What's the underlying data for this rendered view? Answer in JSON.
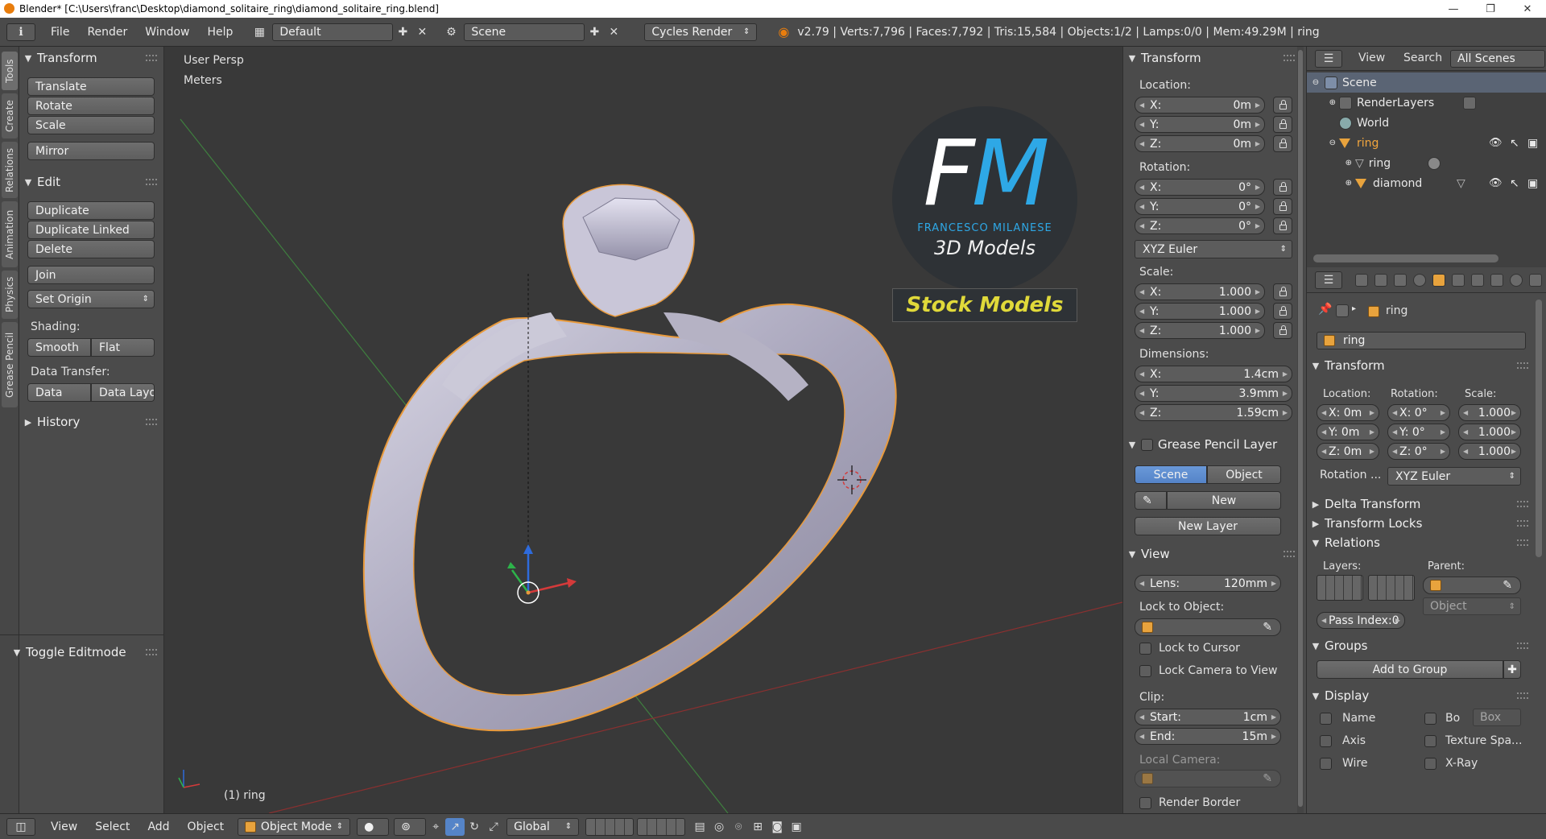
{
  "window": {
    "title": "Blender* [C:\\Users\\franc\\Desktop\\diamond_solitaire_ring\\diamond_solitaire_ring.blend]",
    "minimize": "—",
    "maximize": "❐",
    "close": "✕"
  },
  "topbar": {
    "info_icon": "ℹ",
    "menus": [
      "File",
      "Render",
      "Window",
      "Help"
    ],
    "screen_layout": "Default",
    "scene": "Scene",
    "engine": "Cycles Render",
    "stats": "v2.79 | Verts:7,796 | Faces:7,792 | Tris:15,584 | Objects:1/2 | Lamps:0/0 | Mem:49.29M | ring"
  },
  "tool_tabs": [
    "Tools",
    "Create",
    "Relations",
    "Animation",
    "Physics",
    "Grease Pencil"
  ],
  "toolshelf": {
    "transform_header": "Transform",
    "translate": "Translate",
    "rotate": "Rotate",
    "scale": "Scale",
    "mirror": "Mirror",
    "edit_header": "Edit",
    "duplicate": "Duplicate",
    "duplicate_linked": "Duplicate Linked",
    "delete": "Delete",
    "join": "Join",
    "set_origin": "Set Origin",
    "shading_label": "Shading:",
    "smooth": "Smooth",
    "flat": "Flat",
    "data_transfer_label": "Data Transfer:",
    "data": "Data",
    "data_layout": "Data Layo",
    "history_header": "History",
    "toggle_editmode": "Toggle Editmode"
  },
  "viewport": {
    "view_name": "User Persp",
    "units": "Meters",
    "object_label": "(1) ring",
    "watermark_initials": "FM",
    "watermark_name": "FRANCESCO MILANESE",
    "watermark_sub": "3D Models",
    "watermark_banner": "Stock Models",
    "colors": {
      "background": "#393939",
      "ring": "#b7b4c8",
      "outline": "#e89a3c"
    }
  },
  "npanel": {
    "transform_header": "Transform",
    "location_label": "Location:",
    "location": [
      {
        "axis": "X:",
        "value": "0m"
      },
      {
        "axis": "Y:",
        "value": "0m"
      },
      {
        "axis": "Z:",
        "value": "0m"
      }
    ],
    "rotation_label": "Rotation:",
    "rotation": [
      {
        "axis": "X:",
        "value": "0°"
      },
      {
        "axis": "Y:",
        "value": "0°"
      },
      {
        "axis": "Z:",
        "value": "0°"
      }
    ],
    "rotation_mode": "XYZ Euler",
    "scale_label": "Scale:",
    "scale": [
      {
        "axis": "X:",
        "value": "1.000"
      },
      {
        "axis": "Y:",
        "value": "1.000"
      },
      {
        "axis": "Z:",
        "value": "1.000"
      }
    ],
    "dimensions_label": "Dimensions:",
    "dimensions": [
      {
        "axis": "X:",
        "value": "1.4cm"
      },
      {
        "axis": "Y:",
        "value": "3.9mm"
      },
      {
        "axis": "Z:",
        "value": "1.59cm"
      }
    ],
    "grease_pencil_header": "Grease Pencil Layer",
    "gp_scene": "Scene",
    "gp_object": "Object",
    "gp_new": "New",
    "gp_new_layer": "New Layer",
    "view_header": "View",
    "lens_label": "Lens:",
    "lens_value": "120mm",
    "lock_to_object_label": "Lock to Object:",
    "lock_to_cursor": "Lock to Cursor",
    "lock_camera_to_view": "Lock Camera to View",
    "clip_label": "Clip:",
    "clip_start_label": "Start:",
    "clip_start": "1cm",
    "clip_end_label": "End:",
    "clip_end": "15m",
    "local_camera_label": "Local Camera:",
    "render_border": "Render Border"
  },
  "outliner": {
    "view": "View",
    "search": "Search",
    "filter": "All Scenes",
    "rows": [
      {
        "label": "Scene",
        "indent": 0
      },
      {
        "label": "RenderLayers",
        "indent": 1
      },
      {
        "label": "World",
        "indent": 1
      },
      {
        "label": "ring",
        "indent": 1
      },
      {
        "label": "ring",
        "indent": 2
      },
      {
        "label": "diamond",
        "indent": 2
      }
    ]
  },
  "properties": {
    "breadcrumb": "ring",
    "object_name": "ring",
    "transform_header": "Transform",
    "location_label": "Location:",
    "rotation_label": "Rotation:",
    "scale_label": "Scale:",
    "loc": [
      "X: 0m",
      "Y: 0m",
      "Z: 0m"
    ],
    "rot": [
      "X:  0°",
      "Y:  0°",
      "Z:  0°"
    ],
    "scl": [
      "1.000",
      "1.000",
      "1.000"
    ],
    "rotation_mode_label": "Rotation ...",
    "rotation_mode": "XYZ Euler",
    "delta_transform": "Delta Transform",
    "transform_locks": "Transform Locks",
    "relations": "Relations",
    "layers_label": "Layers:",
    "parent_label": "Parent:",
    "parent_type": "Object",
    "pass_index": "Pass Index:0",
    "groups": "Groups",
    "add_to_group": "Add to Group",
    "display": "Display",
    "name": "Name",
    "bo": "Bo",
    "box": "Box",
    "axis": "Axis",
    "texture_space": "Texture Spa...",
    "wire": "Wire",
    "xray": "X-Ray"
  },
  "bottombar": {
    "menus": [
      "View",
      "Select",
      "Add",
      "Object"
    ],
    "mode": "Object Mode",
    "orientation": "Global"
  }
}
